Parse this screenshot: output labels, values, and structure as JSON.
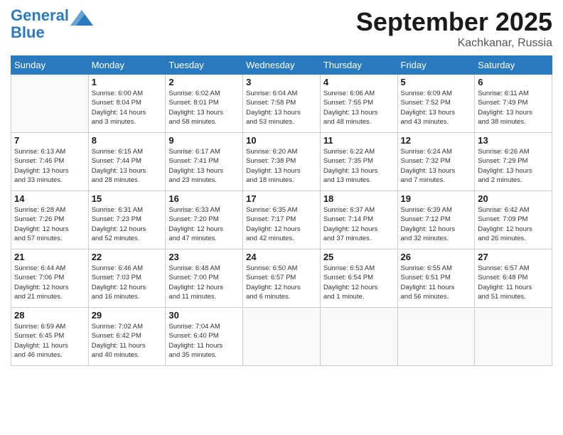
{
  "header": {
    "logo_line1": "General",
    "logo_line2": "Blue",
    "month_title": "September 2025",
    "location": "Kachkanar, Russia"
  },
  "weekdays": [
    "Sunday",
    "Monday",
    "Tuesday",
    "Wednesday",
    "Thursday",
    "Friday",
    "Saturday"
  ],
  "weeks": [
    [
      {
        "day": "",
        "info": ""
      },
      {
        "day": "1",
        "info": "Sunrise: 6:00 AM\nSunset: 8:04 PM\nDaylight: 14 hours\nand 3 minutes."
      },
      {
        "day": "2",
        "info": "Sunrise: 6:02 AM\nSunset: 8:01 PM\nDaylight: 13 hours\nand 58 minutes."
      },
      {
        "day": "3",
        "info": "Sunrise: 6:04 AM\nSunset: 7:58 PM\nDaylight: 13 hours\nand 53 minutes."
      },
      {
        "day": "4",
        "info": "Sunrise: 6:06 AM\nSunset: 7:55 PM\nDaylight: 13 hours\nand 48 minutes."
      },
      {
        "day": "5",
        "info": "Sunrise: 6:09 AM\nSunset: 7:52 PM\nDaylight: 13 hours\nand 43 minutes."
      },
      {
        "day": "6",
        "info": "Sunrise: 6:11 AM\nSunset: 7:49 PM\nDaylight: 13 hours\nand 38 minutes."
      }
    ],
    [
      {
        "day": "7",
        "info": "Sunrise: 6:13 AM\nSunset: 7:46 PM\nDaylight: 13 hours\nand 33 minutes."
      },
      {
        "day": "8",
        "info": "Sunrise: 6:15 AM\nSunset: 7:44 PM\nDaylight: 13 hours\nand 28 minutes."
      },
      {
        "day": "9",
        "info": "Sunrise: 6:17 AM\nSunset: 7:41 PM\nDaylight: 13 hours\nand 23 minutes."
      },
      {
        "day": "10",
        "info": "Sunrise: 6:20 AM\nSunset: 7:38 PM\nDaylight: 13 hours\nand 18 minutes."
      },
      {
        "day": "11",
        "info": "Sunrise: 6:22 AM\nSunset: 7:35 PM\nDaylight: 13 hours\nand 13 minutes."
      },
      {
        "day": "12",
        "info": "Sunrise: 6:24 AM\nSunset: 7:32 PM\nDaylight: 13 hours\nand 7 minutes."
      },
      {
        "day": "13",
        "info": "Sunrise: 6:26 AM\nSunset: 7:29 PM\nDaylight: 13 hours\nand 2 minutes."
      }
    ],
    [
      {
        "day": "14",
        "info": "Sunrise: 6:28 AM\nSunset: 7:26 PM\nDaylight: 12 hours\nand 57 minutes."
      },
      {
        "day": "15",
        "info": "Sunrise: 6:31 AM\nSunset: 7:23 PM\nDaylight: 12 hours\nand 52 minutes."
      },
      {
        "day": "16",
        "info": "Sunrise: 6:33 AM\nSunset: 7:20 PM\nDaylight: 12 hours\nand 47 minutes."
      },
      {
        "day": "17",
        "info": "Sunrise: 6:35 AM\nSunset: 7:17 PM\nDaylight: 12 hours\nand 42 minutes."
      },
      {
        "day": "18",
        "info": "Sunrise: 6:37 AM\nSunset: 7:14 PM\nDaylight: 12 hours\nand 37 minutes."
      },
      {
        "day": "19",
        "info": "Sunrise: 6:39 AM\nSunset: 7:12 PM\nDaylight: 12 hours\nand 32 minutes."
      },
      {
        "day": "20",
        "info": "Sunrise: 6:42 AM\nSunset: 7:09 PM\nDaylight: 12 hours\nand 26 minutes."
      }
    ],
    [
      {
        "day": "21",
        "info": "Sunrise: 6:44 AM\nSunset: 7:06 PM\nDaylight: 12 hours\nand 21 minutes."
      },
      {
        "day": "22",
        "info": "Sunrise: 6:46 AM\nSunset: 7:03 PM\nDaylight: 12 hours\nand 16 minutes."
      },
      {
        "day": "23",
        "info": "Sunrise: 6:48 AM\nSunset: 7:00 PM\nDaylight: 12 hours\nand 11 minutes."
      },
      {
        "day": "24",
        "info": "Sunrise: 6:50 AM\nSunset: 6:57 PM\nDaylight: 12 hours\nand 6 minutes."
      },
      {
        "day": "25",
        "info": "Sunrise: 6:53 AM\nSunset: 6:54 PM\nDaylight: 12 hours\nand 1 minute."
      },
      {
        "day": "26",
        "info": "Sunrise: 6:55 AM\nSunset: 6:51 PM\nDaylight: 11 hours\nand 56 minutes."
      },
      {
        "day": "27",
        "info": "Sunrise: 6:57 AM\nSunset: 6:48 PM\nDaylight: 11 hours\nand 51 minutes."
      }
    ],
    [
      {
        "day": "28",
        "info": "Sunrise: 6:59 AM\nSunset: 6:45 PM\nDaylight: 11 hours\nand 46 minutes."
      },
      {
        "day": "29",
        "info": "Sunrise: 7:02 AM\nSunset: 6:42 PM\nDaylight: 11 hours\nand 40 minutes."
      },
      {
        "day": "30",
        "info": "Sunrise: 7:04 AM\nSunset: 6:40 PM\nDaylight: 11 hours\nand 35 minutes."
      },
      {
        "day": "",
        "info": ""
      },
      {
        "day": "",
        "info": ""
      },
      {
        "day": "",
        "info": ""
      },
      {
        "day": "",
        "info": ""
      }
    ]
  ]
}
